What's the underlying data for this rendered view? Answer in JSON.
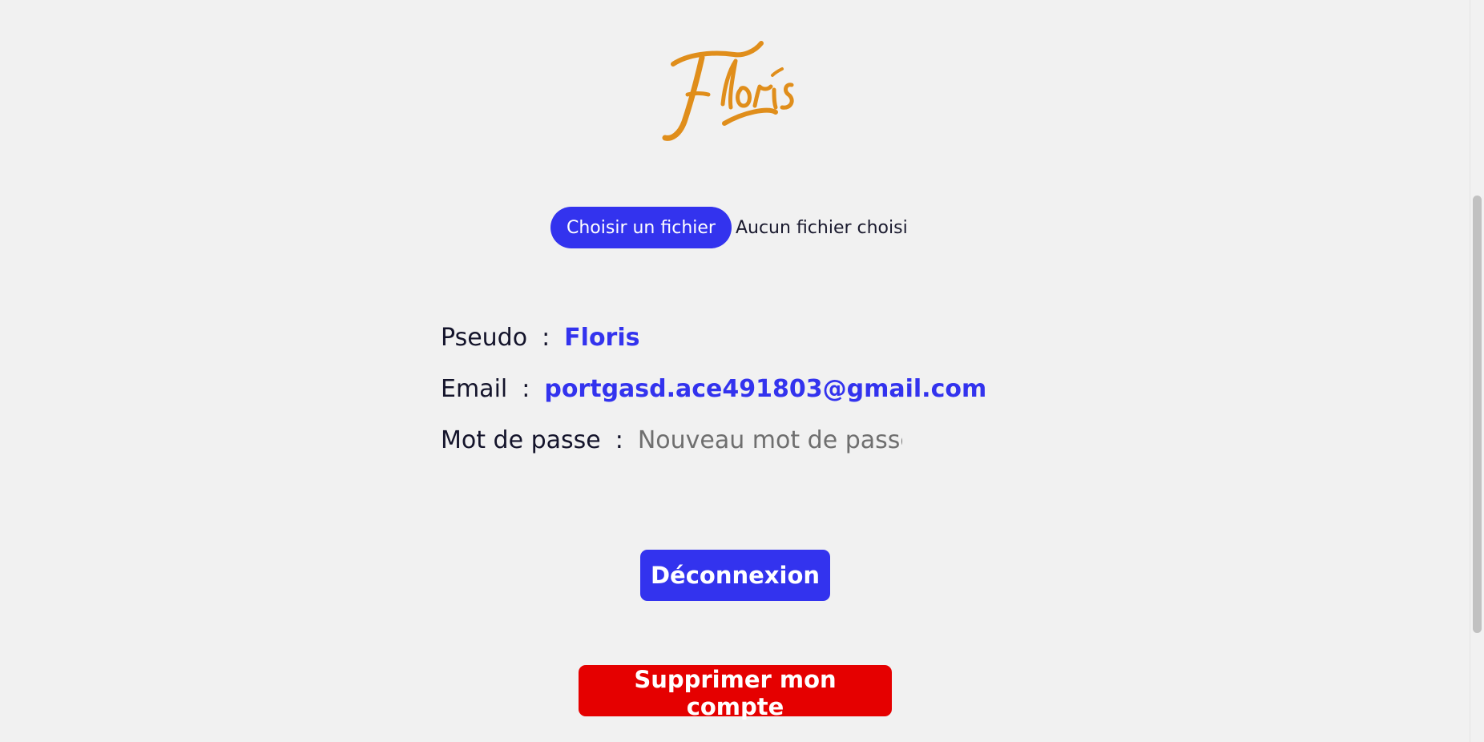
{
  "logo": {
    "text": "Floris",
    "color": "#e08e1b"
  },
  "file_upload": {
    "button_label": "Choisir un fichier",
    "status": "Aucun fichier choisi"
  },
  "profile": {
    "pseudo_label": "Pseudo",
    "pseudo_value": "Floris",
    "email_label": "Email",
    "email_value": "portgasd.ace491803@gmail.com",
    "password_label": "Mot de passe",
    "password_placeholder": "Nouveau mot de passe",
    "separator": ":"
  },
  "actions": {
    "logout_label": "Déconnexion",
    "delete_label": "Supprimer mon compte"
  },
  "colors": {
    "accent": "#3333ee",
    "danger": "#e50000",
    "background": "#f1f1f1"
  }
}
